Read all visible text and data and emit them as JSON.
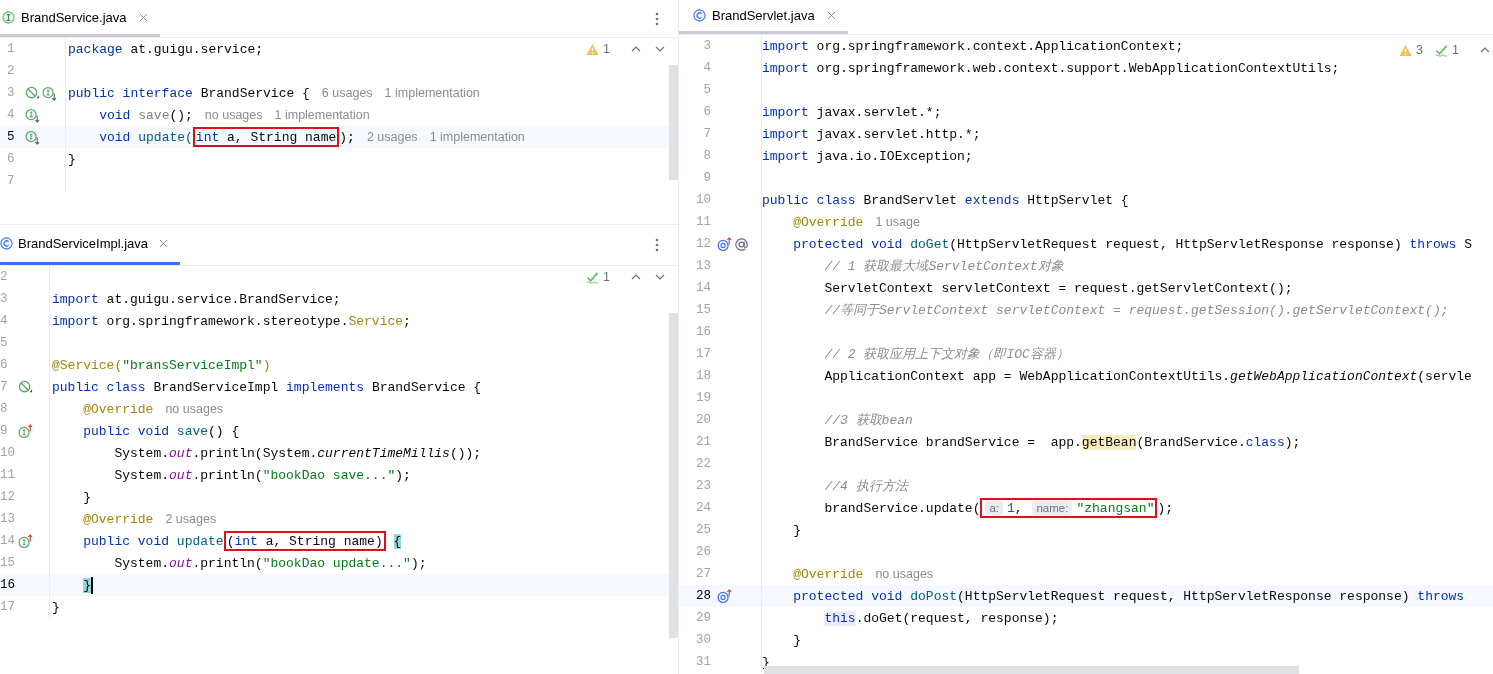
{
  "editors": [
    {
      "tab": {
        "label": "BrandService.java",
        "kind": "interface",
        "focused": false
      },
      "inspections": [
        {
          "kind": "warning",
          "count": "1"
        }
      ],
      "nav": [
        {
          "kind": "up"
        },
        {
          "kind": "down"
        }
      ],
      "lines": [
        {
          "number": "1",
          "current": false,
          "caret": false,
          "tokens": [
            {
              "kind": "kw",
              "text": "package"
            },
            {
              "kind": "plain",
              "text": " at.guigu.service;"
            }
          ]
        },
        {
          "number": "2",
          "current": false,
          "caret": false
        },
        {
          "number": "3",
          "current": false,
          "caret": false,
          "markers": [
            {
              "kind": "no-bean"
            },
            {
              "kind": "implemented"
            }
          ],
          "tokens": [
            {
              "kind": "kw",
              "text": "public interface"
            },
            {
              "kind": "plain",
              "text": " BrandService {"
            },
            {
              "kind": "hint",
              "text": "6 usages"
            },
            {
              "kind": "hint",
              "text": "1 implementation"
            }
          ]
        },
        {
          "number": "4",
          "current": false,
          "caret": false,
          "markers": [
            {
              "kind": "implemented"
            }
          ],
          "tokens": [
            {
              "kind": "kw",
              "text": "    void"
            },
            {
              "kind": "unused",
              "text": " save"
            },
            {
              "kind": "plain",
              "text": "();"
            },
            {
              "kind": "hint",
              "text": "no usages"
            },
            {
              "kind": "hint",
              "text": "1 implementation"
            }
          ]
        },
        {
          "number": "5",
          "current": true,
          "caret": false,
          "markers": [
            {
              "kind": "implemented"
            }
          ],
          "tokens": [
            {
              "kind": "kw",
              "text": "    void"
            },
            {
              "kind": "decl",
              "text": " update("
            },
            {
              "kind": "box",
              "children": [
                {
                  "kind": "kw",
                  "text": "int"
                },
                {
                  "kind": "plain",
                  "text": " a, String name"
                }
              ]
            },
            {
              "kind": "plain",
              "text": ");"
            },
            {
              "kind": "hint",
              "text": "2 usages"
            },
            {
              "kind": "hint",
              "text": "1 implementation"
            }
          ]
        },
        {
          "number": "6",
          "current": false,
          "caret": false,
          "tokens": [
            {
              "kind": "plain",
              "text": "}"
            }
          ]
        },
        {
          "number": "7",
          "current": false,
          "caret": false
        }
      ]
    },
    {
      "tab": {
        "label": "BrandServiceImpl.java",
        "kind": "class",
        "focused": true
      },
      "inspections": [
        {
          "kind": "passed",
          "count": "1"
        }
      ],
      "nav": [
        {
          "kind": "up"
        },
        {
          "kind": "down"
        }
      ],
      "lines": [
        {
          "number": "2",
          "current": false,
          "caret": false
        },
        {
          "number": "3",
          "current": false,
          "caret": false,
          "tokens": [
            {
              "kind": "kw",
              "text": "import"
            },
            {
              "kind": "plain",
              "text": " at.guigu.service.BrandService;"
            }
          ]
        },
        {
          "number": "4",
          "current": false,
          "caret": false,
          "tokens": [
            {
              "kind": "kw",
              "text": "import"
            },
            {
              "kind": "plain",
              "text": " org.springframework.stereotype."
            },
            {
              "kind": "ann",
              "text": "Service"
            },
            {
              "kind": "plain",
              "text": ";"
            }
          ]
        },
        {
          "number": "5",
          "current": false,
          "caret": false
        },
        {
          "number": "6",
          "current": false,
          "caret": false,
          "tokens": [
            {
              "kind": "ann",
              "text": "@Service("
            },
            {
              "kind": "str",
              "text": "\"bransServiceImpl\""
            },
            {
              "kind": "ann",
              "text": ")"
            }
          ]
        },
        {
          "number": "7",
          "current": false,
          "caret": false,
          "markers": [
            {
              "kind": "no-bean"
            }
          ],
          "tokens": [
            {
              "kind": "kw",
              "text": "public class"
            },
            {
              "kind": "plain",
              "text": " BrandServiceImpl "
            },
            {
              "kind": "kw",
              "text": "implements"
            },
            {
              "kind": "plain",
              "text": " BrandService {"
            }
          ]
        },
        {
          "number": "8",
          "current": false,
          "caret": false,
          "tokens": [
            {
              "kind": "ann",
              "text": "    @Override"
            },
            {
              "kind": "hint",
              "text": "no usages"
            }
          ]
        },
        {
          "number": "9",
          "current": false,
          "caret": false,
          "markers": [
            {
              "kind": "implementing"
            }
          ],
          "tokens": [
            {
              "kind": "kw",
              "text": "    public void"
            },
            {
              "kind": "decl",
              "text": " save"
            },
            {
              "kind": "plain",
              "text": "() {"
            }
          ]
        },
        {
          "number": "10",
          "current": false,
          "caret": false,
          "tokens": [
            {
              "kind": "plain",
              "text": "        System."
            },
            {
              "kind": "field",
              "text": "out"
            },
            {
              "kind": "plain",
              "text": ".println(System."
            },
            {
              "kind": "static",
              "text": "currentTimeMillis"
            },
            {
              "kind": "plain",
              "text": "());"
            }
          ]
        },
        {
          "number": "11",
          "current": false,
          "caret": false,
          "tokens": [
            {
              "kind": "plain",
              "text": "        System."
            },
            {
              "kind": "field",
              "text": "out"
            },
            {
              "kind": "plain",
              "text": ".println("
            },
            {
              "kind": "str",
              "text": "\"bookDao save...\""
            },
            {
              "kind": "plain",
              "text": ");"
            }
          ]
        },
        {
          "number": "12",
          "current": false,
          "caret": false,
          "tokens": [
            {
              "kind": "plain",
              "text": "    }"
            }
          ]
        },
        {
          "number": "13",
          "current": false,
          "caret": false,
          "tokens": [
            {
              "kind": "ann",
              "text": "    @Override"
            },
            {
              "kind": "hint",
              "text": "2 usages"
            }
          ]
        },
        {
          "number": "14",
          "current": false,
          "caret": false,
          "markers": [
            {
              "kind": "implementing"
            }
          ],
          "tokens": [
            {
              "kind": "kw",
              "text": "    public void"
            },
            {
              "kind": "decl",
              "text": " update"
            },
            {
              "kind": "box",
              "children": [
                {
                  "kind": "plain",
                  "text": "("
                },
                {
                  "kind": "kw",
                  "text": "int"
                },
                {
                  "kind": "plain",
                  "text": " a, String name)"
                }
              ]
            },
            {
              "kind": "match",
              "text": " {"
            }
          ]
        },
        {
          "number": "15",
          "current": false,
          "caret": false,
          "tokens": [
            {
              "kind": "plain",
              "text": "        System."
            },
            {
              "kind": "field",
              "text": "out"
            },
            {
              "kind": "plain",
              "text": ".println("
            },
            {
              "kind": "str",
              "text": "\"bookDao update...\""
            },
            {
              "kind": "plain",
              "text": ");"
            }
          ]
        },
        {
          "number": "16",
          "current": true,
          "caret": true,
          "tokens": [
            {
              "kind": "match",
              "text": "    }"
            }
          ]
        },
        {
          "number": "17",
          "current": false,
          "caret": false,
          "tokens": [
            {
              "kind": "plain",
              "text": "}"
            }
          ]
        }
      ]
    },
    {
      "tab": {
        "label": "BrandServlet.java",
        "kind": "class",
        "focused": false
      },
      "inspections": [
        {
          "kind": "warning",
          "count": "3"
        },
        {
          "kind": "passed",
          "count": "1"
        }
      ],
      "nav": [
        {
          "kind": "up"
        }
      ],
      "lines": [
        {
          "number": "3",
          "current": false,
          "caret": false,
          "tokens": [
            {
              "kind": "kw",
              "text": "import"
            },
            {
              "kind": "plain",
              "text": " org.springframework.context.ApplicationContext;"
            }
          ]
        },
        {
          "number": "4",
          "current": false,
          "caret": false,
          "tokens": [
            {
              "kind": "kw",
              "text": "import"
            },
            {
              "kind": "plain",
              "text": " org.springframework.web.context.support.WebApplicationContextUtils;"
            }
          ]
        },
        {
          "number": "5",
          "current": false,
          "caret": false
        },
        {
          "number": "6",
          "current": false,
          "caret": false,
          "tokens": [
            {
              "kind": "kw",
              "text": "import"
            },
            {
              "kind": "plain",
              "text": " javax.servlet.*;"
            }
          ]
        },
        {
          "number": "7",
          "current": false,
          "caret": false,
          "tokens": [
            {
              "kind": "kw",
              "text": "import"
            },
            {
              "kind": "plain",
              "text": " javax.servlet.http.*;"
            }
          ]
        },
        {
          "number": "8",
          "current": false,
          "caret": false,
          "tokens": [
            {
              "kind": "kw",
              "text": "import"
            },
            {
              "kind": "plain",
              "text": " java.io.IOException;"
            }
          ]
        },
        {
          "number": "9",
          "current": false,
          "caret": false
        },
        {
          "number": "10",
          "current": false,
          "caret": false,
          "tokens": [
            {
              "kind": "kw",
              "text": "public class"
            },
            {
              "kind": "plain",
              "text": " BrandServlet "
            },
            {
              "kind": "kw",
              "text": "extends"
            },
            {
              "kind": "plain",
              "text": " HttpServlet {"
            }
          ]
        },
        {
          "number": "11",
          "current": false,
          "caret": false,
          "tokens": [
            {
              "kind": "ann",
              "text": "    @Override"
            },
            {
              "kind": "hint",
              "text": "1 usage"
            }
          ]
        },
        {
          "number": "12",
          "current": false,
          "caret": false,
          "markers": [
            {
              "kind": "overriding"
            },
            {
              "kind": "endpoint"
            }
          ],
          "tokens": [
            {
              "kind": "kw",
              "text": "    protected void"
            },
            {
              "kind": "decl",
              "text": " doGet"
            },
            {
              "kind": "plain",
              "text": "(HttpServletRequest request, HttpServletResponse response) "
            },
            {
              "kind": "kw",
              "text": "throws"
            },
            {
              "kind": "plain",
              "text": " S"
            }
          ]
        },
        {
          "number": "13",
          "current": false,
          "caret": false,
          "tokens": [
            {
              "kind": "comment",
              "text": "        // 1 获取最大域ServletContext对象"
            }
          ]
        },
        {
          "number": "14",
          "current": false,
          "caret": false,
          "tokens": [
            {
              "kind": "plain",
              "text": "        ServletContext servletContext = request.getServletContext();"
            }
          ]
        },
        {
          "number": "15",
          "current": false,
          "caret": false,
          "tokens": [
            {
              "kind": "comment",
              "text": "        //等同于ServletContext servletContext = request.getSession().getServletContext();"
            }
          ]
        },
        {
          "number": "16",
          "current": false,
          "caret": false
        },
        {
          "number": "17",
          "current": false,
          "caret": false,
          "tokens": [
            {
              "kind": "comment",
              "text": "        // 2 获取应用上下文对象（即IOC容器）"
            }
          ]
        },
        {
          "number": "18",
          "current": false,
          "caret": false,
          "tokens": [
            {
              "kind": "plain",
              "text": "        ApplicationContext app = WebApplicationContextUtils."
            },
            {
              "kind": "static",
              "text": "getWebApplicationContext"
            },
            {
              "kind": "plain",
              "text": "(servle"
            }
          ]
        },
        {
          "number": "19",
          "current": false,
          "caret": false
        },
        {
          "number": "20",
          "current": false,
          "caret": false,
          "tokens": [
            {
              "kind": "comment",
              "text": "        //3 获取bean"
            }
          ]
        },
        {
          "number": "21",
          "current": false,
          "caret": false,
          "tokens": [
            {
              "kind": "plain",
              "text": "        BrandService brandService =  app."
            },
            {
              "kind": "usage",
              "text": "getBean"
            },
            {
              "kind": "plain",
              "text": "(BrandService."
            },
            {
              "kind": "kw",
              "text": "class"
            },
            {
              "kind": "plain",
              "text": ");"
            }
          ]
        },
        {
          "number": "22",
          "current": false,
          "caret": false
        },
        {
          "number": "23",
          "current": false,
          "caret": false,
          "tokens": [
            {
              "kind": "comment",
              "text": "        //4 执行方法"
            }
          ]
        },
        {
          "number": "24",
          "current": false,
          "caret": false,
          "tokens": [
            {
              "kind": "plain",
              "text": "        brandService.update("
            },
            {
              "kind": "box",
              "children": [
                {
                  "kind": "inlay",
                  "text": "a:"
                },
                {
                  "kind": "num",
                  "text": "1"
                },
                {
                  "kind": "plain",
                  "text": ", "
                },
                {
                  "kind": "inlay",
                  "text": "name:"
                },
                {
                  "kind": "str",
                  "text": "\"zhangsan\""
                }
              ]
            },
            {
              "kind": "plain",
              "text": ");"
            }
          ]
        },
        {
          "number": "25",
          "current": false,
          "caret": false,
          "tokens": [
            {
              "kind": "plain",
              "text": "    }"
            }
          ]
        },
        {
          "number": "26",
          "current": false,
          "caret": false
        },
        {
          "number": "27",
          "current": false,
          "caret": false,
          "tokens": [
            {
              "kind": "ann",
              "text": "    @Override"
            },
            {
              "kind": "hint",
              "text": "no usages"
            }
          ]
        },
        {
          "number": "28",
          "current": true,
          "caret": false,
          "markers": [
            {
              "kind": "overriding"
            }
          ],
          "tokens": [
            {
              "kind": "kw",
              "text": "    protected void"
            },
            {
              "kind": "decl",
              "text": " doPost"
            },
            {
              "kind": "plain",
              "text": "(HttpServletRequest request, HttpServletResponse response) "
            },
            {
              "kind": "kw",
              "text": "throws"
            }
          ]
        },
        {
          "number": "29",
          "current": false,
          "caret": false,
          "tokens": [
            {
              "kind": "kwusage",
              "text": "        this"
            },
            {
              "kind": "plain",
              "text": ".doGet(request, response);"
            }
          ]
        },
        {
          "number": "30",
          "current": false,
          "caret": false,
          "tokens": [
            {
              "kind": "plain",
              "text": "    }"
            }
          ]
        },
        {
          "number": "31",
          "current": false,
          "caret": false,
          "tokens": [
            {
              "kind": "plain",
              "text": "}"
            }
          ]
        }
      ]
    }
  ]
}
